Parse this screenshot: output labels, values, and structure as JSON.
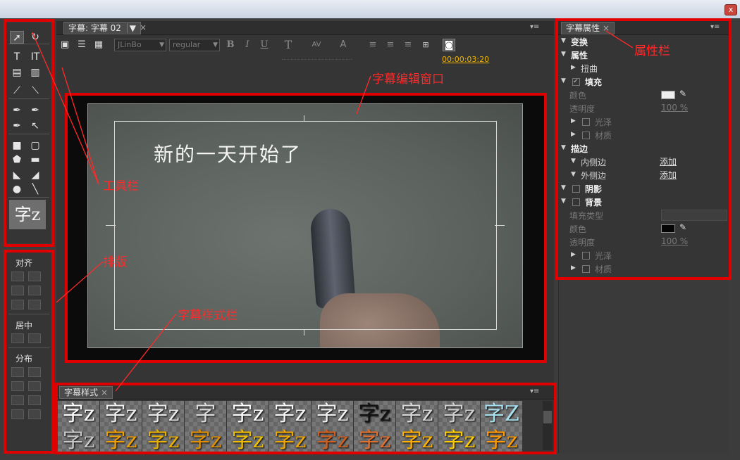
{
  "window": {
    "close_glyph": "x"
  },
  "tools": {
    "thumb_text": "字z",
    "items": [
      {
        "name": "selection-tool-icon",
        "glyph": "➚"
      },
      {
        "name": "rotation-tool-icon",
        "glyph": "↻"
      },
      {
        "name": "type-tool-icon",
        "glyph": "T"
      },
      {
        "name": "vertical-type-tool-icon",
        "glyph": "IT"
      },
      {
        "name": "area-type-tool-icon",
        "glyph": "▤"
      },
      {
        "name": "vertical-area-type-tool-icon",
        "glyph": "▥"
      },
      {
        "name": "path-type-tool-icon",
        "glyph": "⟋"
      },
      {
        "name": "vertical-path-type-tool-icon",
        "glyph": "⟍"
      },
      {
        "name": "pen-tool-icon",
        "glyph": "✒"
      },
      {
        "name": "delete-anchor-tool-icon",
        "glyph": "✒"
      },
      {
        "name": "add-anchor-tool-icon",
        "glyph": "✒"
      },
      {
        "name": "convert-anchor-tool-icon",
        "glyph": "↖"
      },
      {
        "name": "rectangle-tool-icon",
        "glyph": "■"
      },
      {
        "name": "rounded-rect-tool-icon",
        "glyph": "▢"
      },
      {
        "name": "clipped-corner-tool-icon",
        "glyph": "⬟"
      },
      {
        "name": "rounded-corner-tool-icon",
        "glyph": "▬"
      },
      {
        "name": "wedge-tool-icon",
        "glyph": "◣"
      },
      {
        "name": "arc-tool-icon",
        "glyph": "◢"
      },
      {
        "name": "ellipse-tool-icon",
        "glyph": "●"
      },
      {
        "name": "line-tool-icon",
        "glyph": "╲"
      }
    ]
  },
  "layout_panel": {
    "align": "对齐",
    "center": "居中",
    "distribute": "分布"
  },
  "editor": {
    "tab_label": "字幕: 字幕 02",
    "font_family": "JLinBo",
    "font_style": "regular",
    "timecode": "00:00:03:20",
    "caption_text": "新的一天开始了",
    "bold": "B",
    "italic": "I",
    "underline": "U",
    "size": "T",
    "kerning": "AV",
    "leading": "A"
  },
  "styles": {
    "tab_label": "字幕样式",
    "swatches": [
      {
        "text": "字z",
        "color": "#ffffff"
      },
      {
        "text": "字z",
        "color": "#f0f0f0"
      },
      {
        "text": "字z",
        "color": "#e8e8e8"
      },
      {
        "text": "字",
        "color": "#dcdcdc"
      },
      {
        "text": "字z",
        "color": "#ffffff"
      },
      {
        "text": "字z",
        "color": "#f8f8f8"
      },
      {
        "text": "字z",
        "color": "#f0f0f0"
      },
      {
        "text": "字z",
        "color": "#111111"
      },
      {
        "text": "字z",
        "color": "#d8d8d8"
      },
      {
        "text": "字z",
        "color": "#cfcfcf"
      },
      {
        "text": "字Z",
        "color": "#a8e0f0"
      },
      {
        "text": "字z",
        "color": "#c8c8c8"
      },
      {
        "text": "字z",
        "color": "#f0a000"
      },
      {
        "text": "字z",
        "color": "#e8b000"
      },
      {
        "text": "字z",
        "color": "#e09000"
      },
      {
        "text": "字z",
        "color": "#f0c000"
      },
      {
        "text": "字z",
        "color": "#f0a800"
      },
      {
        "text": "字z",
        "color": "#d06020"
      },
      {
        "text": "字z",
        "color": "#e07030"
      },
      {
        "text": "字z",
        "color": "#ffb000"
      },
      {
        "text": "字z",
        "color": "#ffcc00"
      },
      {
        "text": "字z",
        "color": "#ff9a00"
      }
    ]
  },
  "properties": {
    "tab_label": "字幕属性",
    "rows": [
      {
        "indent": 0,
        "arrow": "▼",
        "label": "变换",
        "kind": "hd"
      },
      {
        "indent": 0,
        "arrow": "▼",
        "label": "属性",
        "kind": "hd"
      },
      {
        "indent": 1,
        "arrow": "▶",
        "label": "扭曲",
        "kind": "normal"
      },
      {
        "indent": 0,
        "arrow": "▼",
        "label": "填充",
        "kind": "hd",
        "check": "✔"
      },
      {
        "indent": 1,
        "arrow": "",
        "label": "颜色",
        "kind": "dim",
        "value": "swatch-light"
      },
      {
        "indent": 1,
        "arrow": "",
        "label": "透明度",
        "kind": "dim",
        "value": "100 %"
      },
      {
        "indent": 1,
        "arrow": "▶",
        "label": "光泽",
        "kind": "dim",
        "box": true
      },
      {
        "indent": 1,
        "arrow": "▶",
        "label": "材质",
        "kind": "dim",
        "box": true
      },
      {
        "indent": 0,
        "arrow": "▼",
        "label": "描边",
        "kind": "hd"
      },
      {
        "indent": 1,
        "arrow": "▼",
        "label": "内侧边",
        "kind": "normal",
        "link": "添加"
      },
      {
        "indent": 1,
        "arrow": "▼",
        "label": "外侧边",
        "kind": "normal",
        "link": "添加"
      },
      {
        "indent": 0,
        "arrow": "▼",
        "label": "阴影",
        "kind": "hd",
        "box": true
      },
      {
        "indent": 0,
        "arrow": "▼",
        "label": "背景",
        "kind": "hd",
        "box": true
      },
      {
        "indent": 1,
        "arrow": "",
        "label": "填充类型",
        "kind": "dim",
        "value": "dropdown"
      },
      {
        "indent": 1,
        "arrow": "",
        "label": "颜色",
        "kind": "dim",
        "value": "swatch-dark"
      },
      {
        "indent": 1,
        "arrow": "",
        "label": "透明度",
        "kind": "dim",
        "value": "100 %"
      },
      {
        "indent": 1,
        "arrow": "▶",
        "label": "光泽",
        "kind": "dim",
        "box": true
      },
      {
        "indent": 1,
        "arrow": "▶",
        "label": "材质",
        "kind": "dim",
        "box": true
      }
    ]
  },
  "annotations": {
    "toolbar": "工具栏",
    "layout": "排版",
    "styles": "字幕样式栏",
    "editor": "字幕编辑窗口",
    "properties": "属性栏"
  },
  "colors": {
    "highlight": "#e00000",
    "timecode": "#f0b400"
  }
}
